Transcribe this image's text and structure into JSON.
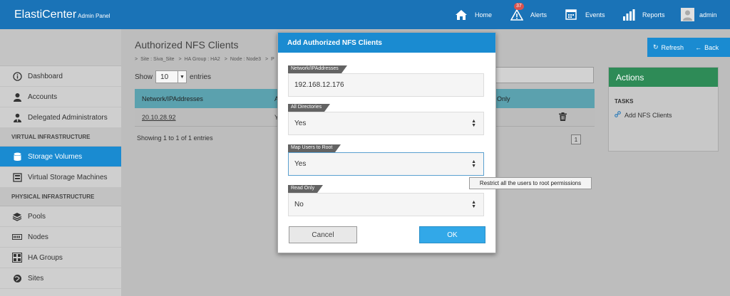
{
  "app": {
    "brand": "ElastiCenter",
    "brand_sub": "Admin Panel"
  },
  "topnav": {
    "home": "Home",
    "alerts": "Alerts",
    "alerts_count": "37",
    "events": "Events",
    "reports": "Reports",
    "user": "admin"
  },
  "sidebar": {
    "items_top": [
      {
        "label": "Dashboard",
        "icon": "info-icon"
      },
      {
        "label": "Accounts",
        "icon": "user-icon"
      },
      {
        "label": "Delegated Administrators",
        "icon": "delegated-user-icon"
      }
    ],
    "section_virtual": "VIRTUAL INFRASTRUCTURE",
    "items_virtual": [
      {
        "label": "Storage Volumes",
        "icon": "database-icon",
        "active": true
      },
      {
        "label": "Virtual Storage Machines",
        "icon": "vsm-icon"
      }
    ],
    "section_physical": "PHYSICAL INFRASTRUCTURE",
    "items_physical": [
      {
        "label": "Pools",
        "icon": "layers-icon"
      },
      {
        "label": "Nodes",
        "icon": "server-icon"
      },
      {
        "label": "HA Groups",
        "icon": "ha-groups-icon"
      },
      {
        "label": "Sites",
        "icon": "sites-icon"
      }
    ]
  },
  "page": {
    "title": "Authorized NFS Clients",
    "breadcrumb": [
      "Site : Siva_Site",
      "HA Group : HA2",
      "Node : Node3",
      "P"
    ],
    "show_label": "Show",
    "show_value": "10",
    "entries_label": "entries",
    "table": {
      "col1": "Network/IPAddresses",
      "col2": "A",
      "col3": "Only",
      "rows": [
        {
          "network": "20.10.28.92",
          "c2": "Y"
        }
      ]
    },
    "showing": "Showing 1 to 1 of 1 entries",
    "page_num": "1",
    "refresh": "Refresh",
    "back": "Back"
  },
  "actions": {
    "title": "Actions",
    "tasks_label": "TASKS",
    "task1": "Add NFS Clients"
  },
  "modal": {
    "title": "Add Authorized NFS Clients",
    "network_label": "Network/IPAddresses",
    "network_value": "192.168.12.176",
    "all_dirs_label": "All Directories",
    "all_dirs_value": "Yes",
    "map_root_label": "Map Users to Root",
    "map_root_value": "Yes",
    "read_only_label": "Read Only",
    "read_only_value": "No",
    "cancel": "Cancel",
    "ok": "OK",
    "tooltip": "Restrict all the users to root permissions"
  },
  "colors": {
    "topbar": "#1a73b7",
    "accent": "#1a8bd1",
    "actions_header": "#2e8b57",
    "table_header": "#5ba1ae"
  }
}
